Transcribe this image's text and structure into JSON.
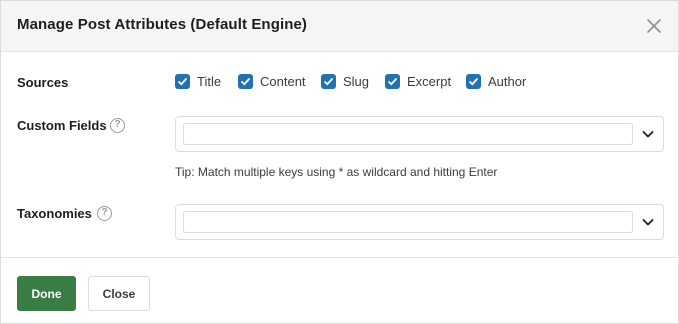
{
  "dialog": {
    "title": "Manage Post Attributes (Default Engine)"
  },
  "sources": {
    "label": "Sources",
    "items": [
      {
        "label": "Title",
        "checked": true
      },
      {
        "label": "Content",
        "checked": true
      },
      {
        "label": "Slug",
        "checked": true
      },
      {
        "label": "Excerpt",
        "checked": true
      },
      {
        "label": "Author",
        "checked": true
      }
    ]
  },
  "custom_fields": {
    "label": "Custom Fields",
    "help_icon": "?",
    "value": "",
    "tip": "Tip: Match multiple keys using * as wildcard and hitting Enter"
  },
  "taxonomies": {
    "label": "Taxonomies",
    "help_icon": "?",
    "value": ""
  },
  "footer": {
    "done_label": "Done",
    "close_label": "Close"
  },
  "colors": {
    "checkbox": "#2271b1",
    "done_button": "#3a7d44",
    "header_bg": "#f5f5f5"
  }
}
